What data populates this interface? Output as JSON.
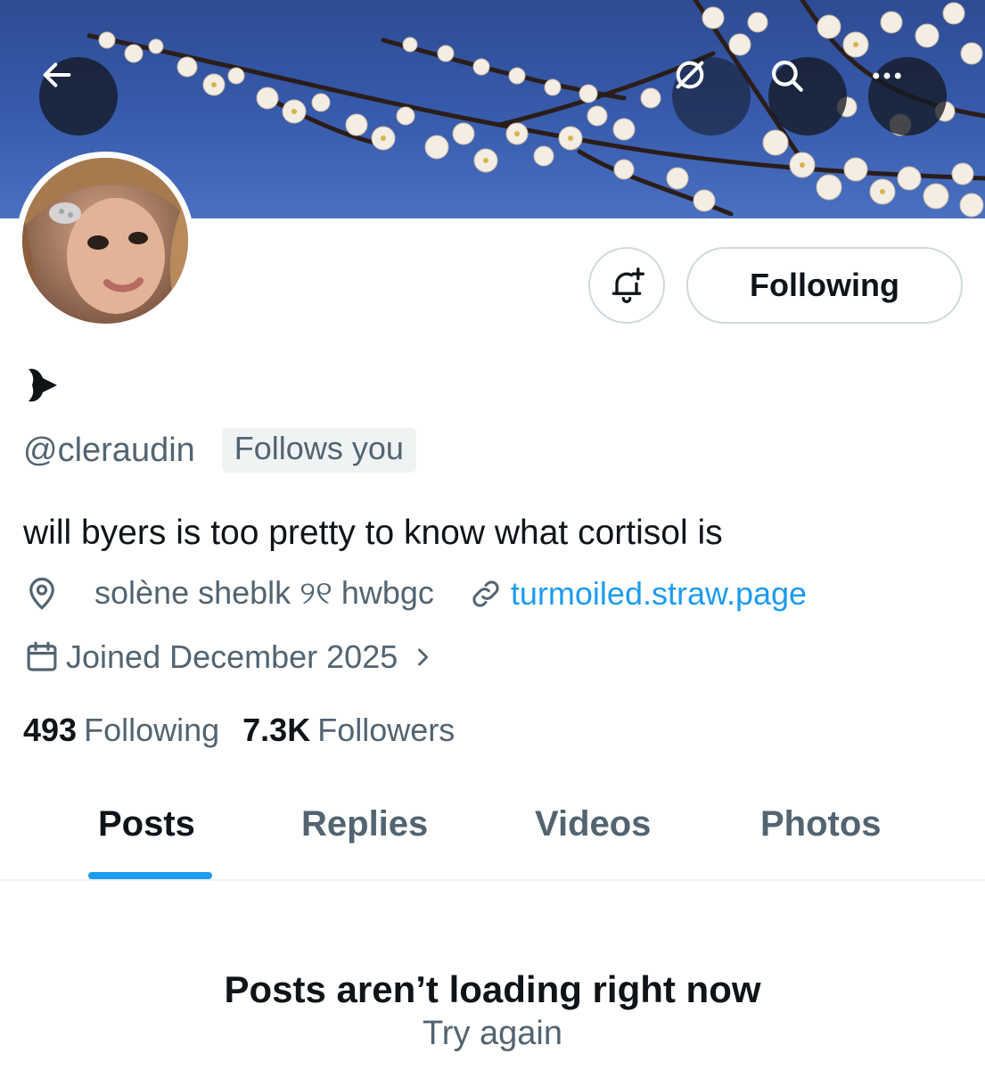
{
  "header": {
    "back_icon": "arrow-left-icon",
    "repost_icon": "repost-off-icon",
    "search_icon": "search-icon",
    "more_icon": "more-horizontal-icon"
  },
  "profile": {
    "display_name_icon": "black-heart-arrow-glyph",
    "handle": "@cleraudin",
    "follows_you": "Follows you",
    "bio": "will byers is too pretty to know what cortisol is",
    "location": "solène  sheblk ୨୧ hwbgc",
    "link": "turmoiled.straw.page",
    "joined": "Joined December 2025",
    "following_count": "493",
    "following_label": "Following",
    "followers_count": "7.3K",
    "followers_label": "Followers"
  },
  "actions": {
    "notify_icon": "bell-plus-icon",
    "following_button": "Following"
  },
  "tabs": [
    {
      "label": "Posts",
      "active": true
    },
    {
      "label": "Replies",
      "active": false
    },
    {
      "label": "Videos",
      "active": false
    },
    {
      "label": "Photos",
      "active": false
    }
  ],
  "empty_state": {
    "title": "Posts aren’t loading right now",
    "action": "Try again"
  },
  "colors": {
    "accent": "#1d9bf0",
    "text_primary": "#0f1419",
    "text_secondary": "#536471",
    "banner_sky": "#3558a8"
  }
}
